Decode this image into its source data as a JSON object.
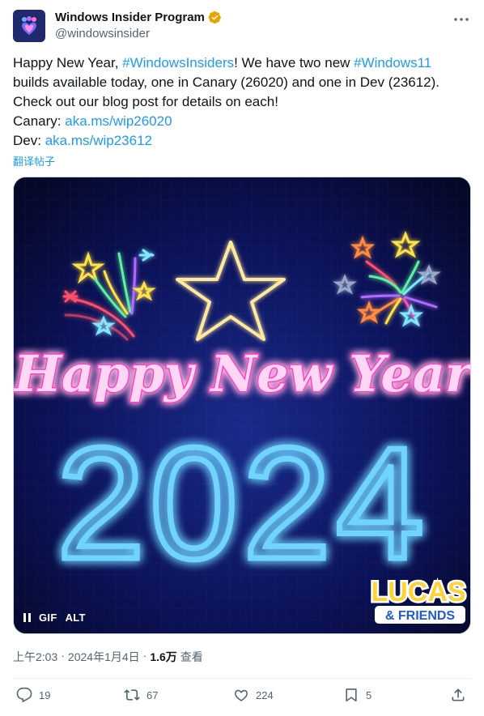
{
  "author": {
    "display_name": "Windows Insider Program",
    "handle": "@windowsinsider"
  },
  "tweet": {
    "line1_a": "Happy New Year, ",
    "line1_hashtag1": "#WindowsInsiders",
    "line1_b": "! We have two new ",
    "line1_hashtag2": "#Windows11",
    "line2": "builds available today, one in Canary (26020) and one in Dev (23612).",
    "line3": "Check out our blog post for details on each!",
    "line4_label": "Canary: ",
    "line4_link": "aka.ms/wip26020",
    "line5_label": "Dev: ",
    "line5_link": "aka.ms/wip23612",
    "translate": "翻译帖子"
  },
  "media": {
    "headline": "Happy New Year",
    "year": "2024",
    "watermark_top": "LUCAS",
    "watermark_bottom": "& FRIENDS",
    "gif_label": "GIF",
    "alt_label": "ALT"
  },
  "meta": {
    "time": "上午2:03",
    "sep1": "·",
    "date": "2024年1月4日",
    "sep2": "·",
    "views_count": "1.6万",
    "views_label": "查看"
  },
  "actions": {
    "replies": "19",
    "retweets": "67",
    "likes": "224",
    "bookmarks": "5"
  },
  "colors": {
    "link": "#1d9bf0",
    "verified": "#e8a500",
    "neon_pink": "#ff3fbf",
    "neon_blue": "#1e9bff",
    "neon_yellow": "#ffe14a"
  }
}
